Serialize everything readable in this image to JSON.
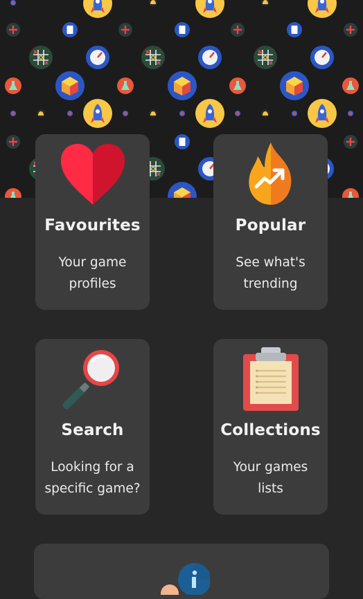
{
  "cards": [
    {
      "title": "Favourites",
      "desc": "Your game profiles",
      "icon": "heart-icon"
    },
    {
      "title": "Popular",
      "desc": "See what's trending",
      "icon": "flame-trending-icon"
    },
    {
      "title": "Search",
      "desc": "Looking for a specific game?",
      "icon": "magnifier-icon"
    },
    {
      "title": "Collections",
      "desc": "Your games lists",
      "icon": "clipboard-icon"
    }
  ],
  "info_card": {
    "icon": "info-icon"
  },
  "colors": {
    "background": "#272727",
    "card": "#3c3c3c",
    "heart": "#e8283e",
    "flame": "#f5a623",
    "magnifier_ring": "#e04848",
    "clipboard": "#e04b4b"
  }
}
